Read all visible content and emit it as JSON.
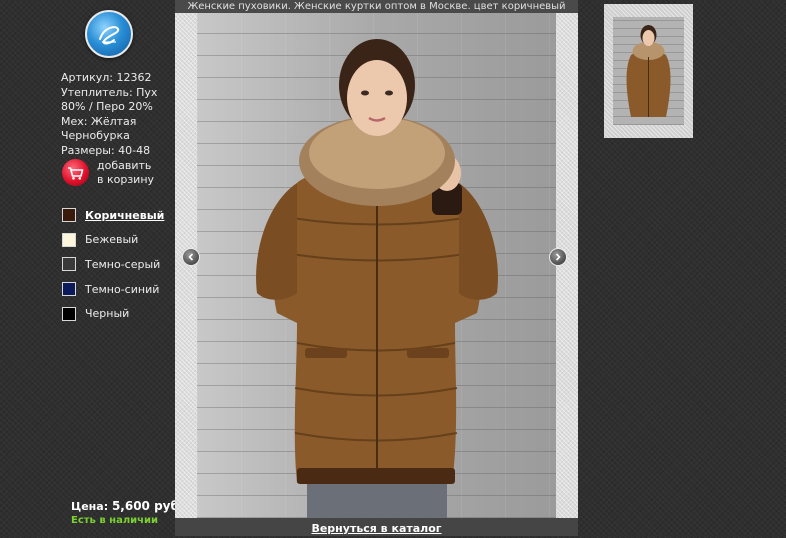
{
  "product": {
    "article": "Артикул: 12362",
    "insulation_line1": "Утеплитель: Пух",
    "insulation_line2": "80% / Перо 20%",
    "fur_line1": "Мех: Жёлтая",
    "fur_line2": "Чернобурка",
    "sizes": "Размеры: 40-48"
  },
  "cart": {
    "label_line1": "добавить",
    "label_line2": "в корзину"
  },
  "colors": [
    {
      "label": "Коричневый",
      "swatch": "#3a1a0a",
      "active": true
    },
    {
      "label": "Бежевый",
      "swatch": "#fbf6dc",
      "active": false
    },
    {
      "label": "Темно-серый",
      "swatch": "#3a3a3a",
      "active": false
    },
    {
      "label": "Темно-синий",
      "swatch": "#0c1a5c",
      "active": false
    },
    {
      "label": "Черный",
      "swatch": "#000000",
      "active": false
    }
  ],
  "price": {
    "label": "Цена:",
    "value": "5,600 руб."
  },
  "availability": "Есть в наличии",
  "viewer": {
    "title": "Женские пуховики. Женские куртки оптом в Москве. цвет коричневый",
    "back_link": "Вернуться в каталог"
  },
  "icons": {
    "logo": "logo-icon",
    "cart": "shopping-cart-icon",
    "prev": "arrow-left-icon",
    "next": "arrow-right-icon"
  },
  "accent_colors": {
    "in_stock": "#7ad12f",
    "cart_red": "#e0112b",
    "jacket_brown": "#8a5a2b"
  }
}
